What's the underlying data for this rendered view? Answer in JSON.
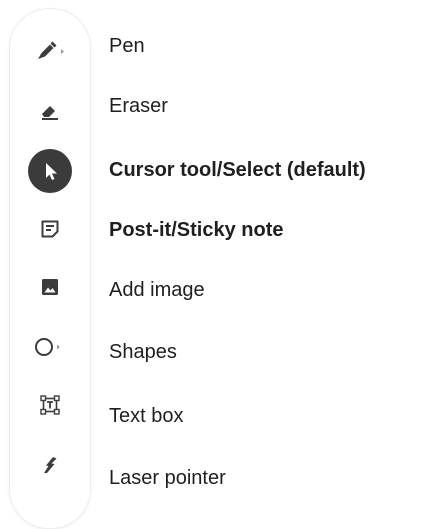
{
  "toolbar": {
    "tools": [
      {
        "icon": "pen-icon",
        "label": "Pen",
        "has_submenu": true,
        "selected": false,
        "bold": false
      },
      {
        "icon": "eraser-icon",
        "label": "Eraser",
        "has_submenu": false,
        "selected": false,
        "bold": false
      },
      {
        "icon": "cursor-icon",
        "label": "Cursor tool/Select (default)",
        "has_submenu": false,
        "selected": true,
        "bold": true
      },
      {
        "icon": "sticky-note-icon",
        "label": "Post-it/Sticky note",
        "has_submenu": false,
        "selected": false,
        "bold": true
      },
      {
        "icon": "image-icon",
        "label": "Add image",
        "has_submenu": false,
        "selected": false,
        "bold": false
      },
      {
        "icon": "shapes-icon",
        "label": "Shapes",
        "has_submenu": true,
        "selected": false,
        "bold": false
      },
      {
        "icon": "text-box-icon",
        "label": "Text box",
        "has_submenu": false,
        "selected": false,
        "bold": false
      },
      {
        "icon": "laser-pointer-icon",
        "label": "Laser pointer",
        "has_submenu": false,
        "selected": false,
        "bold": false
      }
    ]
  },
  "colors": {
    "icon": "#3c3c3c",
    "selected_bg": "#3b3b3b",
    "selected_icon": "#ffffff",
    "text": "#1f1f1f",
    "toolbar_border": "#ededed"
  }
}
